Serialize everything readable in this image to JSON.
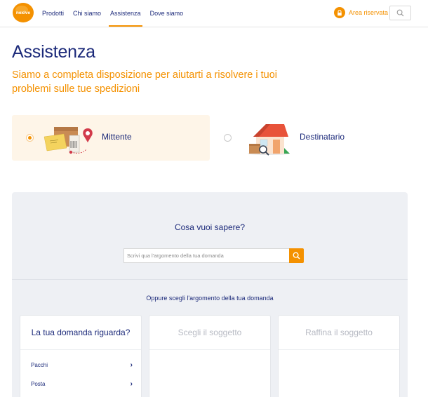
{
  "header": {
    "logo_text": "nexive",
    "nav": [
      {
        "label": "Prodotti",
        "active": false
      },
      {
        "label": "Chi siamo",
        "active": false
      },
      {
        "label": "Assistenza",
        "active": true
      },
      {
        "label": "Dove siamo",
        "active": false
      }
    ],
    "reserved_area_label": "Area riservata",
    "reserved_area_icon": "lock-icon",
    "search_icon": "search-icon"
  },
  "page": {
    "title": "Assistenza",
    "subtitle": "Siamo a completa disposizione per aiutarti a risolvere i tuoi problemi sulle tue spedizioni"
  },
  "options": [
    {
      "label": "Mittente",
      "selected": true,
      "icon": "sender-parcels-illustration"
    },
    {
      "label": "Destinatario",
      "selected": false,
      "icon": "recipient-house-illustration"
    }
  ],
  "help": {
    "title": "Cosa vuoi sapere?",
    "search_placeholder": "Scrivi qua l'argomento della tua domanda",
    "search_button_icon": "search-icon",
    "or_text": "Oppure scegli l'argomento della tua domanda",
    "cards": [
      {
        "title": "La tua domanda riguarda?",
        "items": [
          "Pacchi",
          "Posta"
        ]
      },
      {
        "title": "Scegli il soggetto",
        "items": []
      },
      {
        "title": "Raffina il soggetto",
        "items": []
      }
    ]
  },
  "colors": {
    "brand_orange": "#f49100",
    "navy": "#1c2a7a",
    "panel_bg": "#eef0f4",
    "selected_bg": "#fef5e8"
  }
}
